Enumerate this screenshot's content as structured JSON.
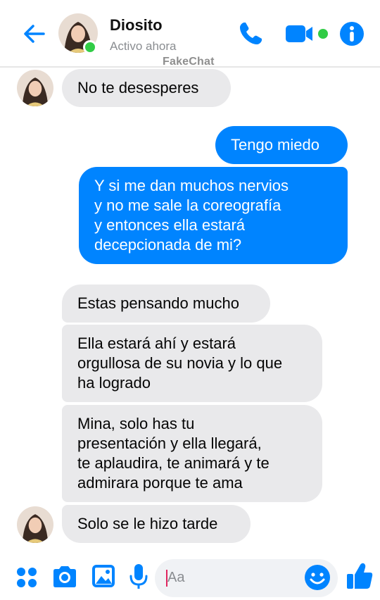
{
  "header": {
    "contact_name": "Diosito",
    "status": "Activo ahora",
    "watermark": "FakeChat",
    "icons": [
      "back-arrow-icon",
      "phone-icon",
      "video-camera-icon",
      "info-icon"
    ]
  },
  "colors": {
    "accent": "#0084ff",
    "online": "#31cc46",
    "incoming_bubble": "#e9e9eb",
    "outgoing_bubble": "#0084ff"
  },
  "messages": [
    {
      "from": "contact",
      "lines": [
        "No te desesperes"
      ]
    },
    {
      "from": "me",
      "lines": [
        "Tengo miedo"
      ]
    },
    {
      "from": "me",
      "lines": [
        "Y si me dan muchos nervios",
        "y no me sale la coreografía",
        "y entonces ella estará",
        "decepcionada de mi?"
      ]
    },
    {
      "from": "contact",
      "lines": [
        "Estas pensando mucho"
      ]
    },
    {
      "from": "contact",
      "lines": [
        "Ella estará ahí y estará",
        "orgullosa de su novia y lo que",
        "ha logrado"
      ]
    },
    {
      "from": "contact",
      "lines": [
        "Mina, solo has tu",
        "presentación y ella llegará,",
        "te aplaudira, te animará y te",
        "admirara porque te ama"
      ]
    },
    {
      "from": "contact",
      "lines": [
        "Solo se le hizo tarde"
      ]
    }
  ],
  "composer": {
    "placeholder": "Aa",
    "icons": [
      "apps-icon",
      "camera-icon",
      "image-icon",
      "microphone-icon",
      "emoji-icon",
      "thumbs-up-icon"
    ]
  }
}
